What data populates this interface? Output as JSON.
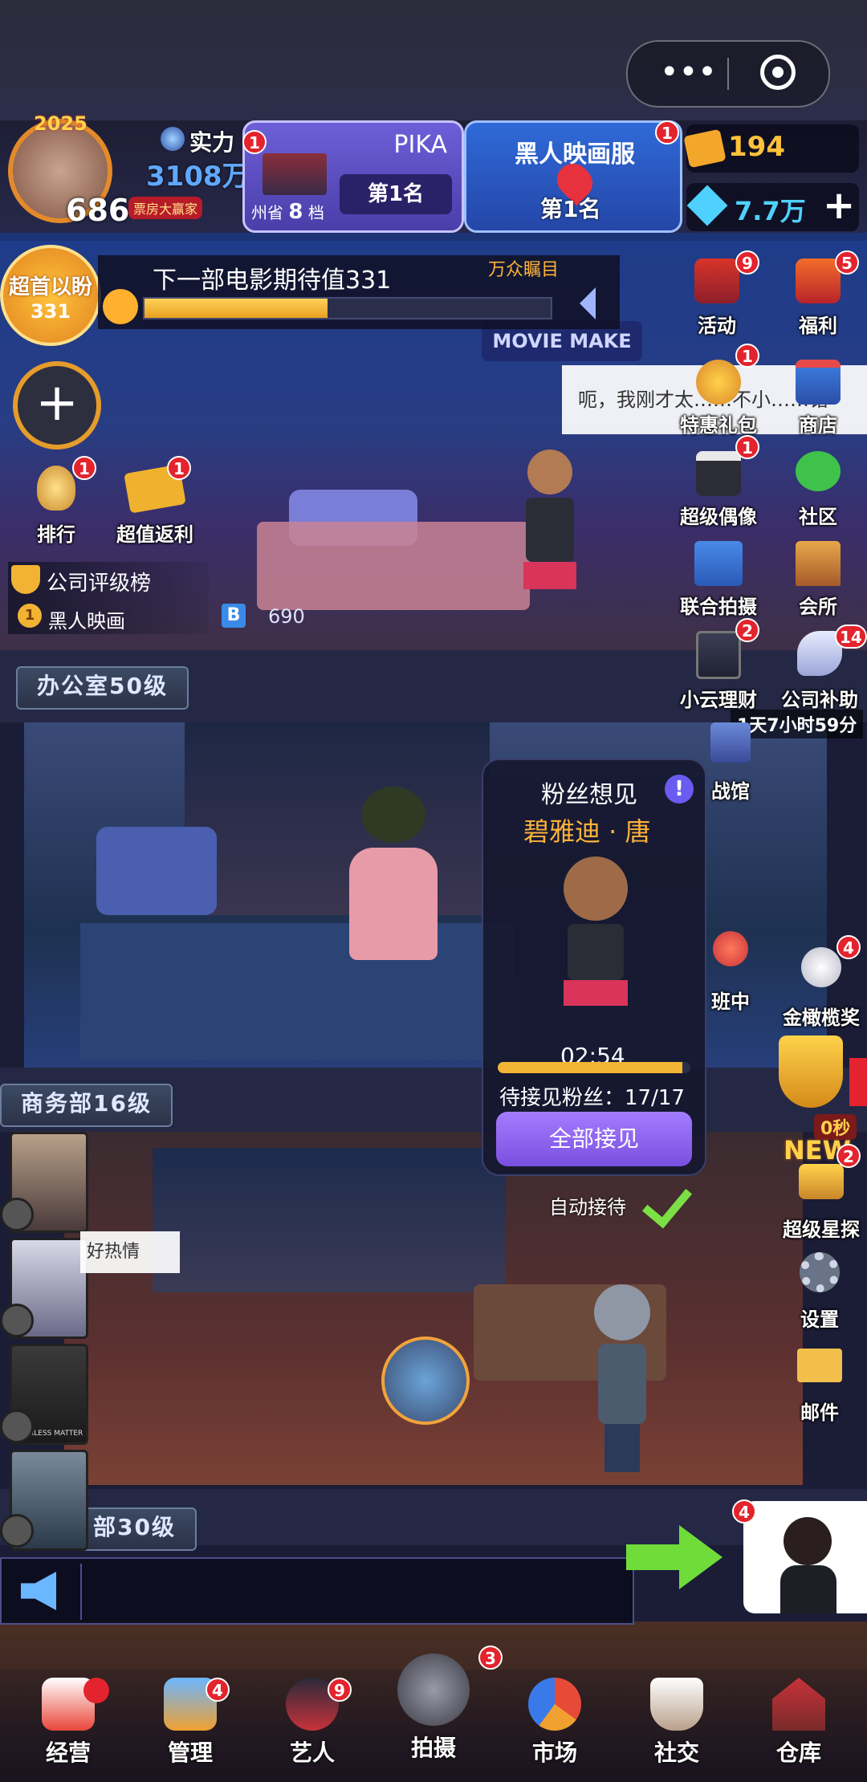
{
  "player": {
    "year_badge": "2025",
    "level": "686",
    "power_label": "实力",
    "power_value": "3108万",
    "title_badge": "票房大赢家"
  },
  "rank_card_1": {
    "name": "PIKA",
    "region_prefix": "州省",
    "tier": "8",
    "tier_suffix": "档",
    "rank": "第1名",
    "badge": "1"
  },
  "rank_card_2": {
    "name": "黑人映画服",
    "rank": "第1名",
    "badge": "1"
  },
  "currency": {
    "tickets": "194",
    "diamonds": "7.7万",
    "add": "+"
  },
  "expectation": {
    "circle_top": "超首以盼",
    "circle_value": "331",
    "label": "下一部电影期待值331",
    "tag": "万众瞩目"
  },
  "left_buttons": [
    {
      "label": "排行",
      "badge": "1"
    },
    {
      "label": "超值返利",
      "badge": "1"
    }
  ],
  "company_rank": {
    "title": "公司评级榜",
    "first": "黑人映画",
    "rank_num": "1",
    "b_value": "690"
  },
  "right_menu": [
    {
      "label": "活动",
      "badge": "9"
    },
    {
      "label": "福利",
      "badge": "5"
    },
    {
      "label": "特惠礼包",
      "badge": "1"
    },
    {
      "label": "商店",
      "badge": ""
    },
    {
      "label": "超级偶像",
      "badge": "1"
    },
    {
      "label": "社区",
      "badge": ""
    },
    {
      "label": "联合拍摄",
      "badge": ""
    },
    {
      "label": "会所",
      "badge": ""
    },
    {
      "label": "小云理财",
      "badge": "2"
    },
    {
      "label": "公司补助",
      "badge": "14"
    }
  ],
  "speech_bubble": "呃，我刚才太……不小……错",
  "countdown": "1天7小时59分",
  "scene": {
    "sign": "MOVIE MAKE",
    "office_label": "办公室50级",
    "business_label": "商务部16级",
    "third_label": "部30级"
  },
  "fan_popup": {
    "title": "粉丝想见",
    "name": "碧雅迪 · 唐",
    "timer": "02:54",
    "waiting": "待接见粉丝：17/17",
    "button": "全部接见",
    "auto": "自动接待"
  },
  "right_lower": [
    {
      "label": "战馆",
      "badge": ""
    },
    {
      "label": "班中",
      "badge": ""
    },
    {
      "label": "金橄榄奖",
      "badge": "4"
    },
    {
      "label": "0秒",
      "badge": ""
    },
    {
      "label": "超级星探",
      "badge": "2"
    },
    {
      "label": "设置",
      "badge": ""
    },
    {
      "label": "邮件",
      "badge": ""
    }
  ],
  "new_tag": "NEW",
  "left_film_tip": "好热情",
  "film_poster_text": "FEARLESS MATTER",
  "secretary_badge": "4",
  "bottom_nav": [
    {
      "label": "经营",
      "badge": ""
    },
    {
      "label": "管理",
      "badge": "4"
    },
    {
      "label": "艺人",
      "badge": "9"
    },
    {
      "label": "拍摄",
      "badge": "3"
    },
    {
      "label": "市场",
      "badge": ""
    },
    {
      "label": "社交",
      "badge": ""
    },
    {
      "label": "仓库",
      "badge": ""
    }
  ],
  "colors": {
    "badge_red": "#e3232d",
    "gold": "#ffc23a",
    "purple_btn": "#8e63e8",
    "progress": "#f3b534",
    "diamond": "#4fd1ff"
  },
  "expectation_progress": 0.45,
  "fan_timer_progress": 0.96
}
